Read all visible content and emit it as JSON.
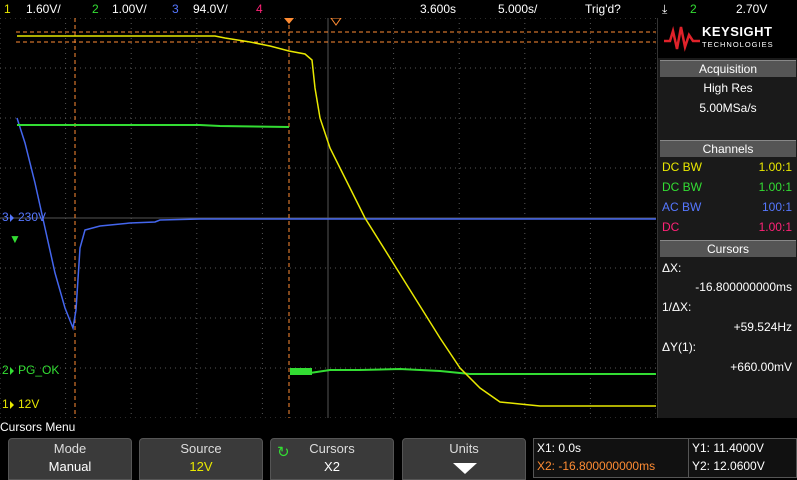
{
  "topbar": {
    "ch1_num": "1",
    "ch1_scale": "1.60V/",
    "ch2_num": "2",
    "ch2_scale": "1.00V/",
    "ch3_num": "3",
    "ch3_scale": "94.0V/",
    "ch4_num": "4",
    "time_pos": "3.600s",
    "time_scale": "5.000s/",
    "trig_status": "Trig'd?",
    "trig_edge": "⤓",
    "trig_source": "2",
    "trig_level": "2.70V"
  },
  "logo": {
    "brand": "KEYSIGHT",
    "sub": "TECHNOLOGIES"
  },
  "acquisition": {
    "title": "Acquisition",
    "mode": "High Res",
    "rate": "5.00MSa/s"
  },
  "channels": {
    "title": "Channels",
    "items": [
      {
        "coupling": "DC BW",
        "probe": "1.00:1",
        "color": "#e8e800"
      },
      {
        "coupling": "DC BW",
        "probe": "1.00:1",
        "color": "#33dd33"
      },
      {
        "coupling": "AC BW",
        "probe": "100:1",
        "color": "#5577ff"
      },
      {
        "coupling": "DC",
        "probe": "1.00:1",
        "color": "#ff2277"
      }
    ]
  },
  "cursors": {
    "title": "Cursors",
    "dx_label": "ΔX:",
    "dx_value": "-16.800000000ms",
    "inv_dx_label": "1/ΔX:",
    "inv_dx_value": "+59.524Hz",
    "dy_label": "ΔY(1):",
    "dy_value": "+660.00mV"
  },
  "trace_labels": {
    "ch3_marker": "3",
    "ch3_label": "230V",
    "ch2_marker": "2",
    "ch2_label": "PG_OK",
    "ch1_marker": "1",
    "ch1_label": "12V"
  },
  "menu": {
    "title": "Cursors Menu",
    "mode_label": "Mode",
    "mode_value": "Manual",
    "source_label": "Source",
    "source_value": "12V",
    "cursors_label": "Cursors",
    "cursors_value": "X2",
    "units_label": "Units",
    "x1": "X1: 0.0s",
    "x2": "X2: -16.800000000ms",
    "y1": "Y1: 11.4000V",
    "y2": "Y2: 12.0600V"
  },
  "colors": {
    "ch1": "#e8e800",
    "ch2": "#33dd33",
    "ch3": "#5577ff",
    "ch4": "#ff2277",
    "cursor": "#ff8c33",
    "grid": "#555555"
  }
}
